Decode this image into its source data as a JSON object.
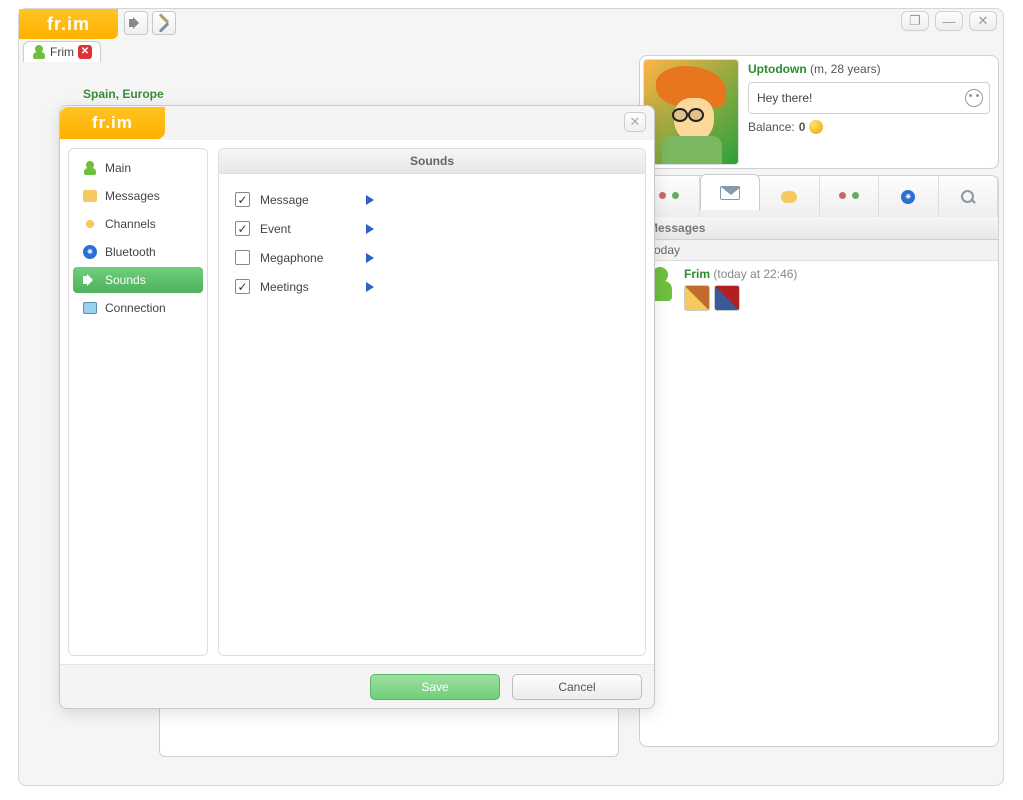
{
  "app": {
    "logo_text": "fr.im",
    "tab_label": "Frim",
    "location_line": "Spain, Europe"
  },
  "profile": {
    "name": "Uptodown",
    "meta": "(m, 28 years)",
    "status_text": "Hey there!",
    "balance_label": "Balance:",
    "balance_value": "0"
  },
  "messages_panel": {
    "header": "Messages",
    "date_label": "Today",
    "items": [
      {
        "sender": "Frim",
        "time": "(today at 22:46)"
      }
    ]
  },
  "dialog": {
    "logo_text": "fr.im",
    "sidebar": [
      {
        "key": "main",
        "label": "Main",
        "icon": "person"
      },
      {
        "key": "messages",
        "label": "Messages",
        "icon": "msg"
      },
      {
        "key": "channels",
        "label": "Channels",
        "icon": "chan"
      },
      {
        "key": "bluetooth",
        "label": "Bluetooth",
        "icon": "bt"
      },
      {
        "key": "sounds",
        "label": "Sounds",
        "icon": "sound",
        "active": true
      },
      {
        "key": "connection",
        "label": "Connection",
        "icon": "conn"
      }
    ],
    "content_title": "Sounds",
    "sound_items": [
      {
        "label": "Message",
        "checked": true
      },
      {
        "label": "Event",
        "checked": true
      },
      {
        "label": "Megaphone",
        "checked": false
      },
      {
        "label": "Meetings",
        "checked": true
      }
    ],
    "buttons": {
      "save": "Save",
      "cancel": "Cancel"
    }
  }
}
